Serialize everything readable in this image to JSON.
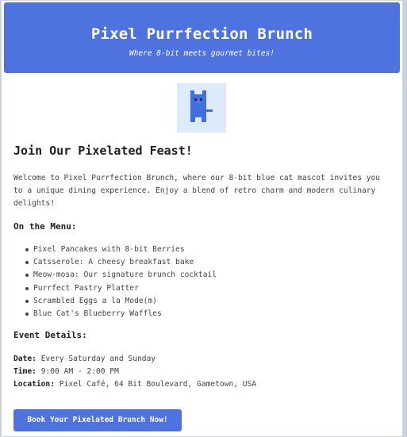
{
  "header": {
    "title": "Pixel Purrfection Brunch",
    "tagline": "Where 8-bit meets gourmet bites!"
  },
  "mascot": {
    "icon": "pixel-blue-cat-icon",
    "color": "#3f6fe0"
  },
  "main": {
    "heading": "Join Our Pixelated Feast!",
    "intro": "Welcome to Pixel Purrfection Brunch, where our 8-bit blue cat mascot invites you to a unique dining experience. Enjoy a blend of retro charm and modern culinary delights!",
    "menu_heading": "On the Menu:",
    "menu_items": [
      "Pixel Pancakes with 8-bit Berries",
      "Catsserole: A cheesy breakfast bake",
      "Meow-mosa: Our signature brunch cocktail",
      "Purrfect Pastry Platter",
      "Scrambled Eggs a la Mode(m)",
      "Blue Cat's Blueberry Waffles"
    ],
    "event_heading": "Event Details:",
    "event": {
      "date_label": "Date:",
      "date_value": "Every Saturday and Sunday",
      "time_label": "Time:",
      "time_value": "9:00 AM - 2:00 PM",
      "location_label": "Location:",
      "location_value": "Pixel Café, 64 Bit Boulevard, Gametown, USA"
    },
    "cta_label": "Book Your Pixelated Brunch Now!"
  },
  "colors": {
    "accent": "#4e73df",
    "mascot_bg": "#ddebfb"
  }
}
